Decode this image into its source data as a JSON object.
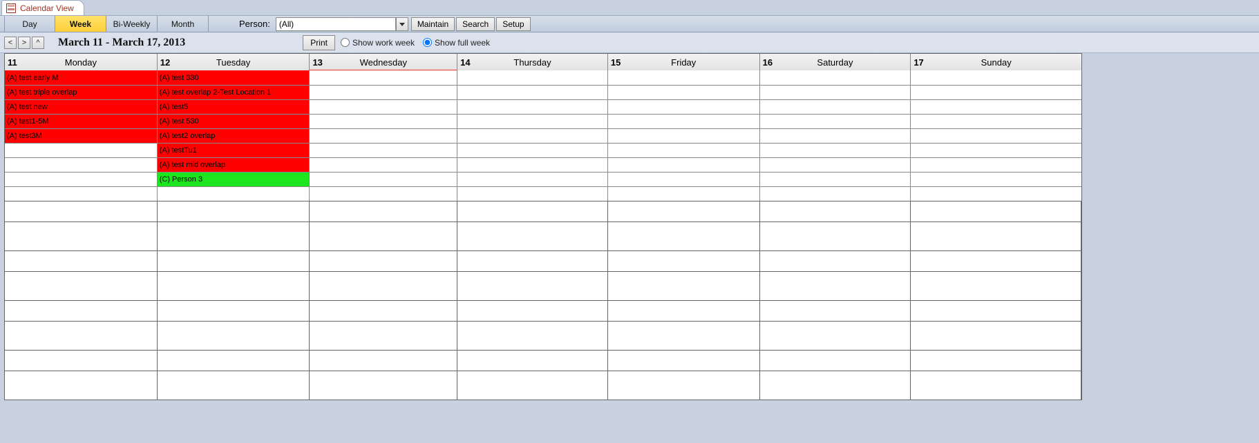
{
  "tab": {
    "title": "Calendar View"
  },
  "views": {
    "day": "Day",
    "week": "Week",
    "biweekly": "Bi-Weekly",
    "month": "Month",
    "active": "week"
  },
  "person": {
    "label": "Person:",
    "value": "(All)"
  },
  "toolbar_buttons": {
    "maintain": "Maintain",
    "search": "Search",
    "setup": "Setup"
  },
  "nav": {
    "prev": "<",
    "next": ">",
    "up": "^"
  },
  "date_range": "March 11 - March 17, 2013",
  "print_label": "Print",
  "radios": {
    "work_week": "Show work week",
    "full_week": "Show full week",
    "selected": "full_week"
  },
  "days": [
    {
      "num": "11",
      "name": "Monday"
    },
    {
      "num": "12",
      "name": "Tuesday"
    },
    {
      "num": "13",
      "name": "Wednesday"
    },
    {
      "num": "14",
      "name": "Thursday"
    },
    {
      "num": "15",
      "name": "Friday"
    },
    {
      "num": "16",
      "name": "Saturday"
    },
    {
      "num": "17",
      "name": "Sunday"
    }
  ],
  "events": {
    "mon": [
      {
        "text": "(A) test early M",
        "color": "red"
      },
      {
        "text": "(A) test triple overlap",
        "color": "red"
      },
      {
        "text": "(A) test new",
        "color": "red"
      },
      {
        "text": "(A) test1-5M",
        "color": "red"
      },
      {
        "text": "(A) test3M",
        "color": "red"
      }
    ],
    "tue": [
      {
        "text": "(A) test 330",
        "color": "red"
      },
      {
        "text": "(A) test overlap 2-Test Location 1",
        "color": "red"
      },
      {
        "text": "(A) test5",
        "color": "red"
      },
      {
        "text": "(A) test 530",
        "color": "red"
      },
      {
        "text": "(A) test2 overlap",
        "color": "red"
      },
      {
        "text": "(A) testTu1",
        "color": "red"
      },
      {
        "text": "(A) test mid overlap",
        "color": "red"
      },
      {
        "text": "(C) Person 3",
        "color": "green"
      }
    ]
  }
}
